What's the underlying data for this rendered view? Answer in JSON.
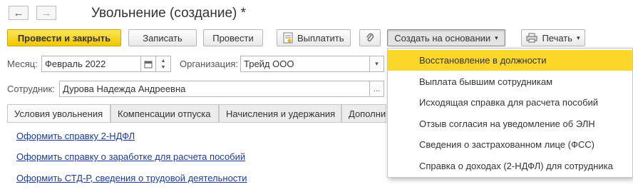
{
  "window": {
    "title": "Увольнение (создание) *"
  },
  "nav": {
    "back_glyph": "←",
    "forward_glyph": "→"
  },
  "toolbar": {
    "post_close": "Провести и закрыть",
    "save": "Записать",
    "post": "Провести",
    "pay": "Выплатить",
    "create_based": "Создать на основании",
    "print": "Печать"
  },
  "form": {
    "month_label": "Месяц:",
    "month_value": "Февраль 2022",
    "org_label": "Организация:",
    "org_value": "Трейд ООО",
    "employee_label": "Сотрудник:",
    "employee_value": "Дурова Надежда Андреевна"
  },
  "tabs": [
    {
      "label": "Условия увольнения",
      "active": true
    },
    {
      "label": "Компенсации отпуска",
      "active": false
    },
    {
      "label": "Начисления и удержания",
      "active": false
    },
    {
      "label": "Дополнит",
      "active": false
    }
  ],
  "links": [
    "Оформить справку 2-НДФЛ",
    "Оформить справку о заработке для расчета пособий",
    "Оформить СТД-Р, сведения о трудовой деятельности"
  ],
  "dropdown": {
    "items": [
      {
        "label": "Восстановление в должности",
        "highlighted": true
      },
      {
        "label": "Выплата бывшим сотрудникам",
        "highlighted": false
      },
      {
        "label": "Исходящая справка для расчета пособий",
        "highlighted": false
      },
      {
        "label": "Отзыв согласия на уведомление об ЭЛН",
        "highlighted": false
      },
      {
        "label": "Сведения о застрахованном лице (ФСС)",
        "highlighted": false
      },
      {
        "label": "Справка о доходах (2-НДФЛ) для сотрудника",
        "highlighted": false
      }
    ]
  },
  "icons": {
    "pay": "document-pay-icon",
    "attach": "paperclip-icon",
    "print": "printer-icon",
    "calendar": "calendar-icon",
    "more": "ellipsis-icon",
    "dropdown_arrow": "chevron-down-icon"
  },
  "colors": {
    "primary_button": "#f2c700",
    "highlight": "#fbd72b",
    "link": "#1a3a9a"
  }
}
